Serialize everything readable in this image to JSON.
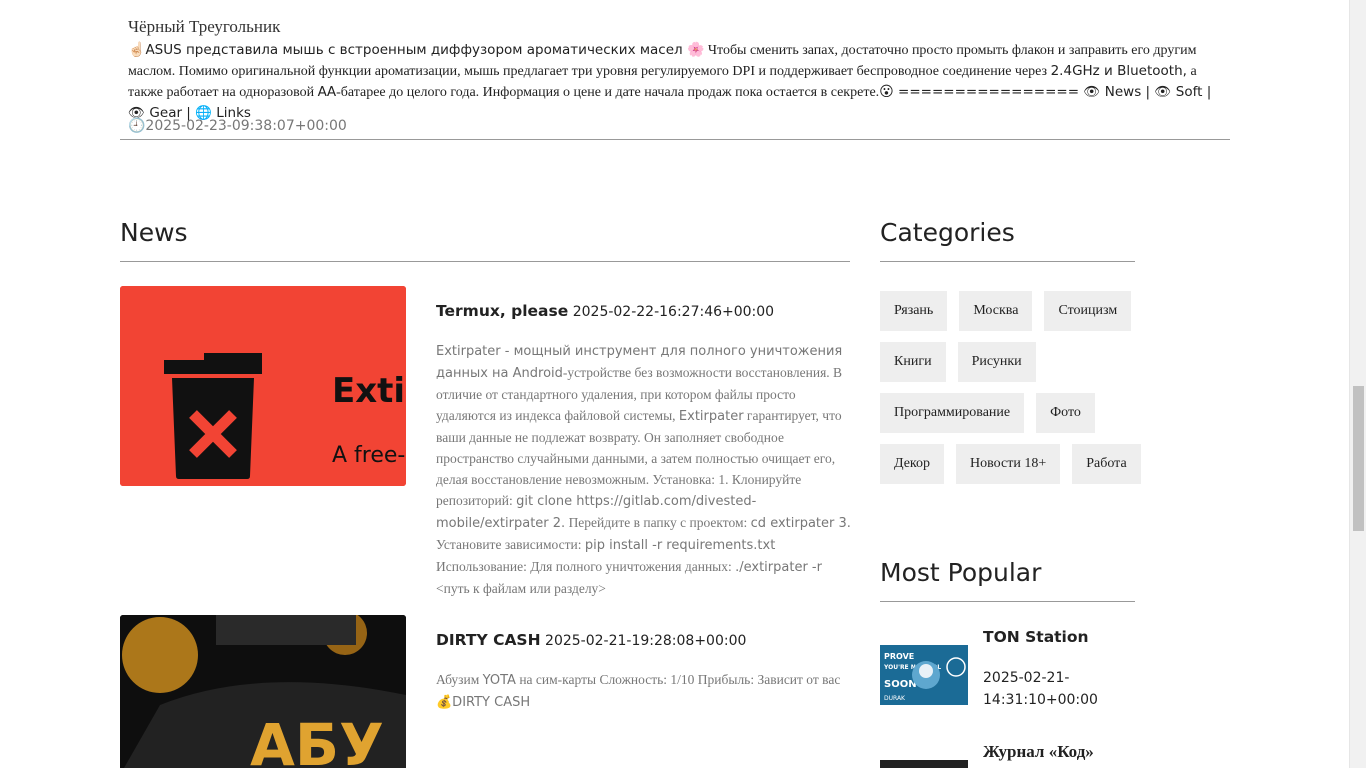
{
  "post": {
    "source": "Чёрный Треугольник",
    "hand_emoji": "☝🏻",
    "part1": "ASUS представила мышь с встроенным диффузором ароматических масел ",
    "flower_emoji": "🌸",
    "part2": " Чтобы сменить запах, достаточно просто промыть флакон и заправить его другим маслом. Помимо оригинальной функции ароматизации, мышь предлагает три уровня регулируемого DPI и поддерживает беспроводное соединение через ",
    "spec": "2.4GHz и Bluetooth,",
    "part3": " а также работает на одноразовой ",
    "aa": "АА",
    "part4": "-батарее до целого года. Информация о цене и дате начала продаж пока остается в секрете.",
    "face_emoji": "😮",
    "links": " ================ 👁 News | 👁 Soft | 👁 Gear | 🌐 Links",
    "date": "🕘2025-02-23-09:38:07+00:00"
  },
  "news": {
    "title": "News",
    "items": [
      {
        "title": "Termux, please",
        "date": "2025-02-22-16:27:46+00:00",
        "image_caption_1": "Extir",
        "image_caption_2": "A free-",
        "text_a": "Extirpater - мощный инструмент для полного уничтожения данных на ",
        "text_b": "Android",
        "text_c": "-устройстве без возможности восстановления. В отличие от стандартного удаления, при котором файлы просто удаляются из индекса файловой системы, ",
        "text_d": "Extirpater",
        "text_e": " гарантирует, что ваши данные не подлежат возврату. Он заполняет свободное пространство случайными данными, а затем полностью очищает его, делая восстановление невозможным. Установка: 1. Клонируйте репозиторий: ",
        "text_f": "git clone https://gitlab.com/divested-mobile/extirpater 2.",
        "text_g": " Перейдите в папку с проектом: ",
        "text_h": "cd extirpater 3.",
        "text_i": " Установите зависимости: ",
        "text_j": "pip install -r requirements.txt",
        "text_k": " Использование: Для полного уничтожения данных: ",
        "text_l": "./extirpater -r",
        "text_m": " <путь к файлам или разделу>"
      },
      {
        "title": "DIRTY CASH",
        "date": "2025-02-21-19:28:08+00:00",
        "image_caption": "АБУ",
        "text_a": "Абузим ",
        "text_b": "YOTA",
        "text_c": " на сим-карты Сложность: 1/10 Прибыль: Зависит от вас ",
        "text_d": "💰DIRTY CASH"
      }
    ]
  },
  "categories": {
    "title": "Categories",
    "items": [
      "Рязань",
      "Москва",
      "Стоицизм",
      "Книги",
      "Рисунки",
      "Программирование",
      "Фото",
      "Декор",
      "Новости 18+",
      "Работа"
    ]
  },
  "popular": {
    "title": "Most Popular",
    "items": [
      {
        "title": "TON Station",
        "date": "2025-02-21-14:31:10+00:00",
        "image_text": "PROVE YOU'RE NO FOOL SOON DURAK"
      },
      {
        "title": "Журнал «Код»"
      }
    ]
  },
  "colors": {
    "accent_red": "#f24434",
    "tag_bg": "#eeeeee",
    "muted_text": "#777777"
  }
}
